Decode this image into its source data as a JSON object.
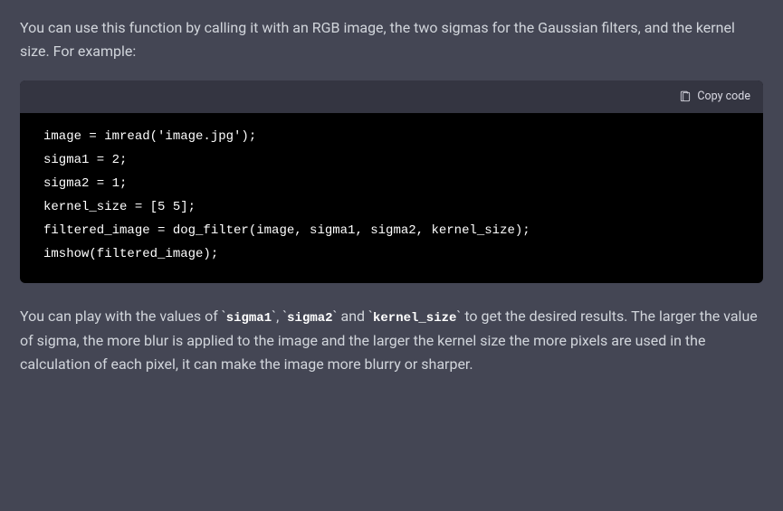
{
  "intro": "You can use this function by calling it with an RGB image, the two sigmas for the Gaussian filters, and the kernel size. For example:",
  "copy_label": "Copy code",
  "code_lines": [
    "image = imread('image.jpg');",
    "sigma1 = 2;",
    "sigma2 = 1;",
    "kernel_size = [5 5];",
    "filtered_image = dog_filter(image, sigma1, sigma2, kernel_size);",
    "imshow(filtered_image);"
  ],
  "outro": {
    "part1": "You can play with the values of ",
    "code1": "sigma1",
    "sep1": ", ",
    "code2": "sigma2",
    "sep2": " and ",
    "code3": "kernel_size",
    "part2": " to get the desired results. The larger the value of sigma, the more blur is applied to the image and the larger the kernel size the more pixels are used in the calculation of each pixel, it can make the image more blurry or sharper."
  }
}
